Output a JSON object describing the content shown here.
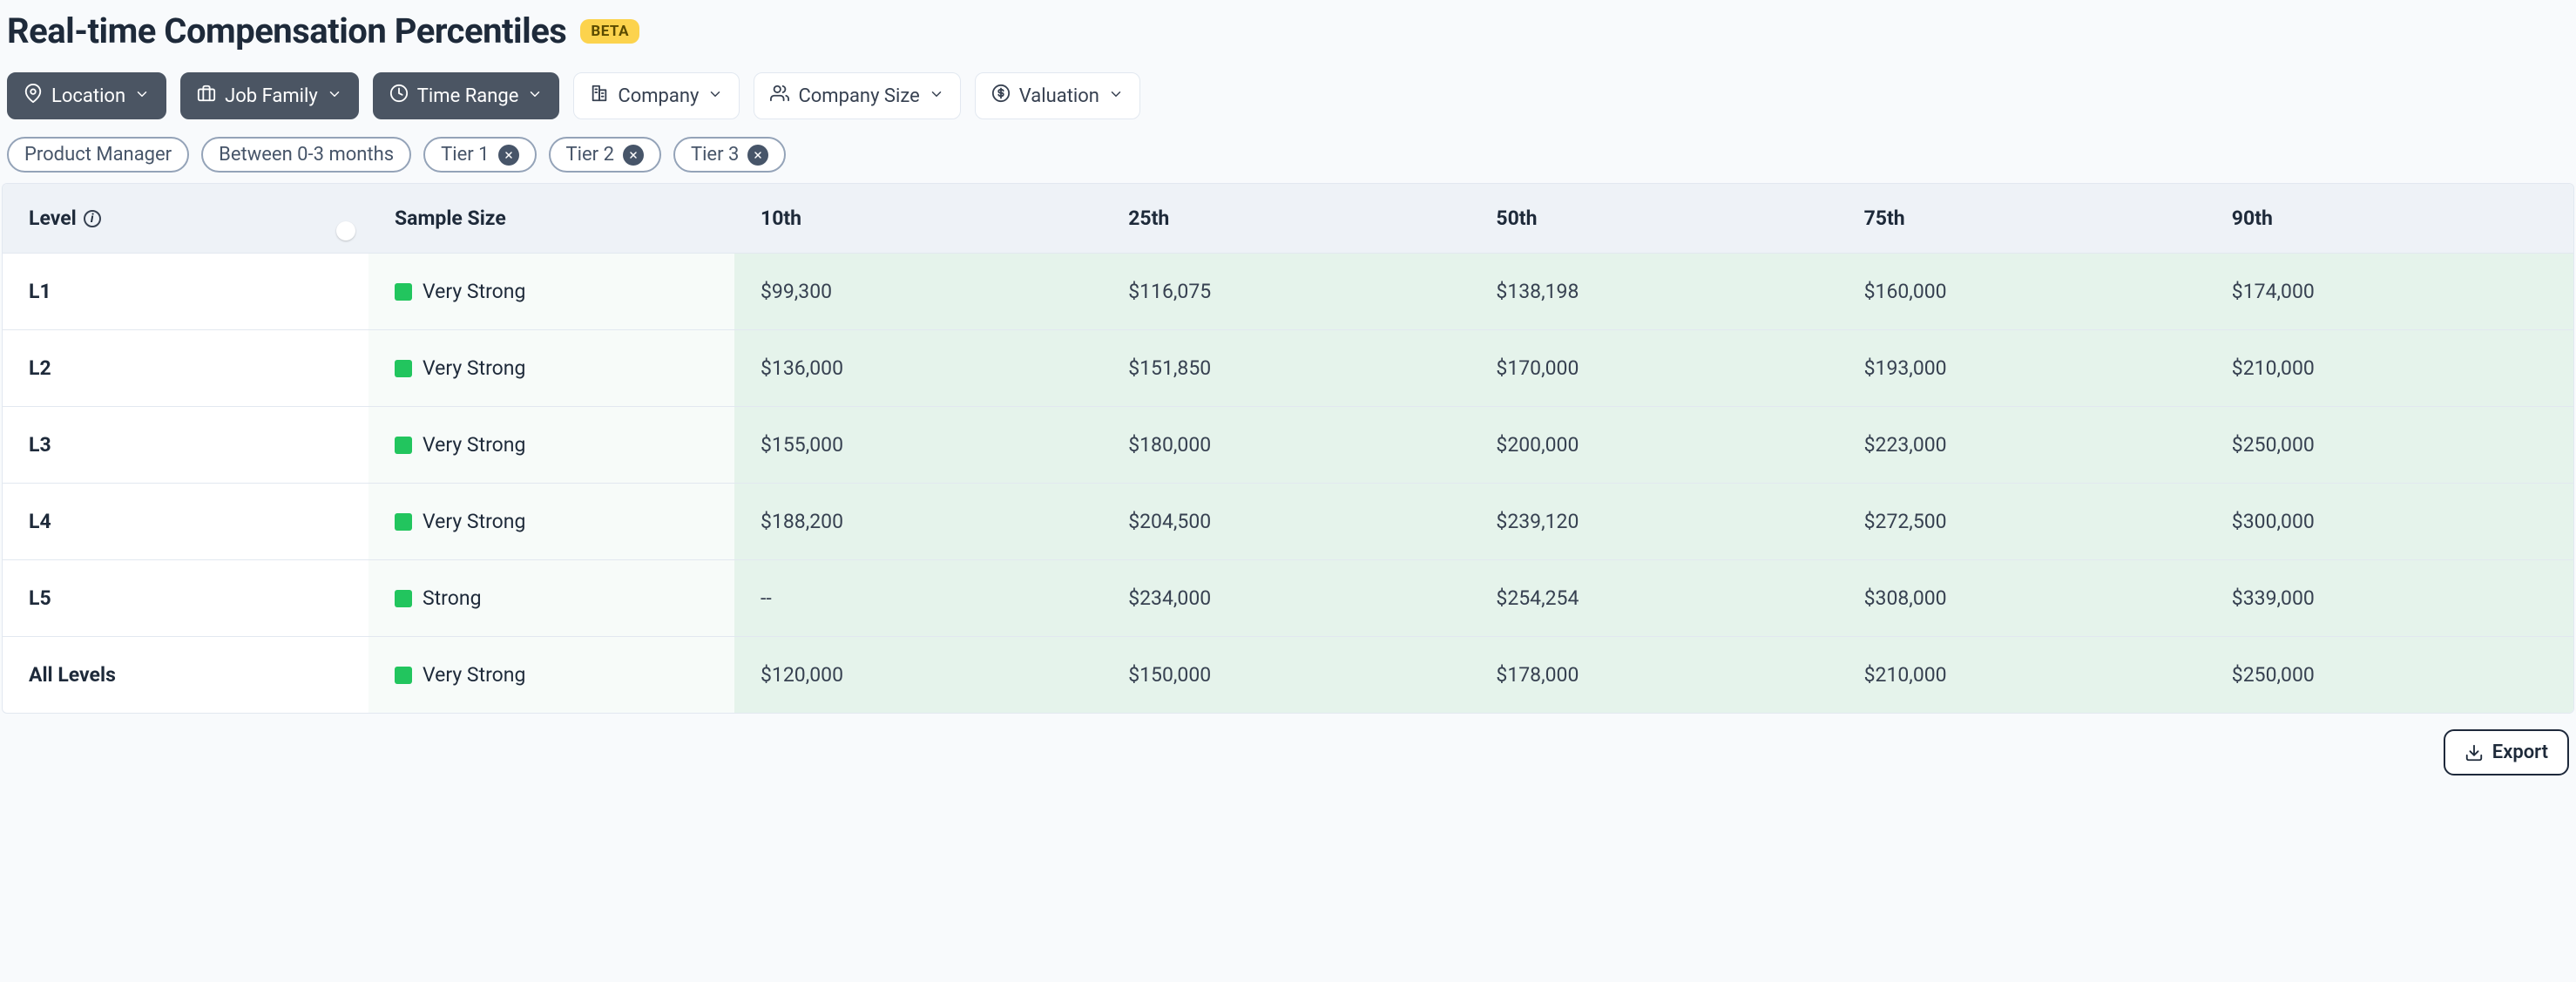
{
  "title": "Real-time Compensation Percentiles",
  "badge": "BETA",
  "filters": [
    {
      "id": "location",
      "label": "Location",
      "icon": "pin",
      "active": true
    },
    {
      "id": "job-family",
      "label": "Job Family",
      "icon": "briefcase",
      "active": true
    },
    {
      "id": "time-range",
      "label": "Time Range",
      "icon": "clock",
      "active": true
    },
    {
      "id": "company",
      "label": "Company",
      "icon": "building",
      "active": false
    },
    {
      "id": "company-size",
      "label": "Company Size",
      "icon": "people",
      "active": false
    },
    {
      "id": "valuation",
      "label": "Valuation",
      "icon": "dollar",
      "active": false
    }
  ],
  "chips": [
    {
      "id": "product-manager",
      "label": "Product Manager",
      "closable": false
    },
    {
      "id": "time-0-3",
      "label": "Between 0-3 months",
      "closable": false
    },
    {
      "id": "tier-1",
      "label": "Tier 1",
      "closable": true
    },
    {
      "id": "tier-2",
      "label": "Tier 2",
      "closable": true
    },
    {
      "id": "tier-3",
      "label": "Tier 3",
      "closable": true
    }
  ],
  "columns": {
    "level": "Level",
    "sample": "Sample Size",
    "p10": "10th",
    "p25": "25th",
    "p50": "50th",
    "p75": "75th",
    "p90": "90th"
  },
  "rows": [
    {
      "level": "L1",
      "sample_label": "Very Strong",
      "p10": "$99,300",
      "p25": "$116,075",
      "p50": "$138,198",
      "p75": "$160,000",
      "p90": "$174,000"
    },
    {
      "level": "L2",
      "sample_label": "Very Strong",
      "p10": "$136,000",
      "p25": "$151,850",
      "p50": "$170,000",
      "p75": "$193,000",
      "p90": "$210,000"
    },
    {
      "level": "L3",
      "sample_label": "Very Strong",
      "p10": "$155,000",
      "p25": "$180,000",
      "p50": "$200,000",
      "p75": "$223,000",
      "p90": "$250,000"
    },
    {
      "level": "L4",
      "sample_label": "Very Strong",
      "p10": "$188,200",
      "p25": "$204,500",
      "p50": "$239,120",
      "p75": "$272,500",
      "p90": "$300,000"
    },
    {
      "level": "L5",
      "sample_label": "Strong",
      "p10": "--",
      "p25": "$234,000",
      "p50": "$254,254",
      "p75": "$308,000",
      "p90": "$339,000"
    },
    {
      "level": "All Levels",
      "sample_label": "Very Strong",
      "p10": "$120,000",
      "p25": "$150,000",
      "p50": "$178,000",
      "p75": "$210,000",
      "p90": "$250,000"
    }
  ],
  "export_label": "Export"
}
